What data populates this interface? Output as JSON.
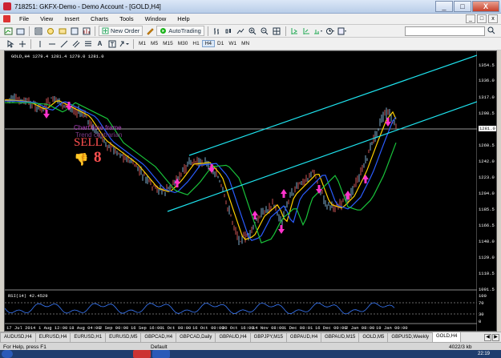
{
  "window": {
    "title": "718251: GKFX-Demo - Demo Account - [GOLD,H4]",
    "minimize": "_",
    "maximize": "□",
    "close": "X"
  },
  "menu": {
    "items": [
      "File",
      "View",
      "Insert",
      "Charts",
      "Tools",
      "Window",
      "Help"
    ],
    "mdi_minimize": "_",
    "mdi_restore": "□",
    "mdi_close": "x"
  },
  "toolbar": {
    "new_order": "New Order",
    "autotrading": "AutoTrading",
    "timeframes": [
      "M1",
      "M5",
      "M15",
      "M30",
      "H1",
      "H4",
      "D1",
      "W1",
      "MN"
    ],
    "active_timeframe": "H4",
    "search_placeholder": ""
  },
  "chart": {
    "symbol_info": "GOLD,H4  1279.4 1281.4 1279.0 1281.0",
    "ea_line1": "Chart time frame",
    "ea_line2": "Trend contrarian",
    "signal": "SELL",
    "signal_count": "8",
    "price_labels": [
      "1354.5",
      "1336.0",
      "1317.0",
      "1298.5",
      "1279.8",
      "1260.5",
      "1242.0",
      "1223.0",
      "1204.0",
      "1185.5",
      "1166.5",
      "1148.0",
      "1129.0",
      "1110.5",
      "1091.5"
    ],
    "current_price": "1281.0",
    "rsi_label": "RSI(14) 42.4529",
    "rsi_levels": [
      "100",
      "70",
      "30",
      "0"
    ],
    "time_labels": [
      "17 Jul 2014",
      "1 Aug 12:00",
      "18 Aug 04:00",
      "2 Sep 00:00",
      "16 Sep 16:00",
      "1 Oct 08:00",
      "16 Oct 00:00",
      "30 Oct 16:00",
      "14 Nov 08:00",
      "1 Dec 08:01",
      "16 Dec 00:00",
      "2 Jan 08:00",
      "19 Jan 00:00"
    ]
  },
  "tabs": {
    "items": [
      "AUDUSD,H4",
      "EURUSD,H4",
      "EURUSD,H1",
      "EURUSD,M5",
      "GBPCAD,H4",
      "GBPCAD,Daily",
      "GBPAUD,H4",
      "GBPJPY,M15",
      "GBPAUD,H4",
      "GBPAUD,M15",
      "GOLD,M5",
      "GBPUSD,Weekly",
      "GOLD,H4"
    ],
    "active": "GOLD,H4"
  },
  "status": {
    "help": "For Help, press F1",
    "profile": "Default",
    "connection": "4022/3 kb"
  },
  "taskbar": {
    "clock": "22:19"
  },
  "colors": {
    "channel": "#1ee3ee",
    "ma_fast": "#ffd000",
    "ma_mid": "#2a5cff",
    "ma_slow": "#19c23a",
    "arrow": "#ff33cc",
    "rsi": "#3a7bff"
  }
}
